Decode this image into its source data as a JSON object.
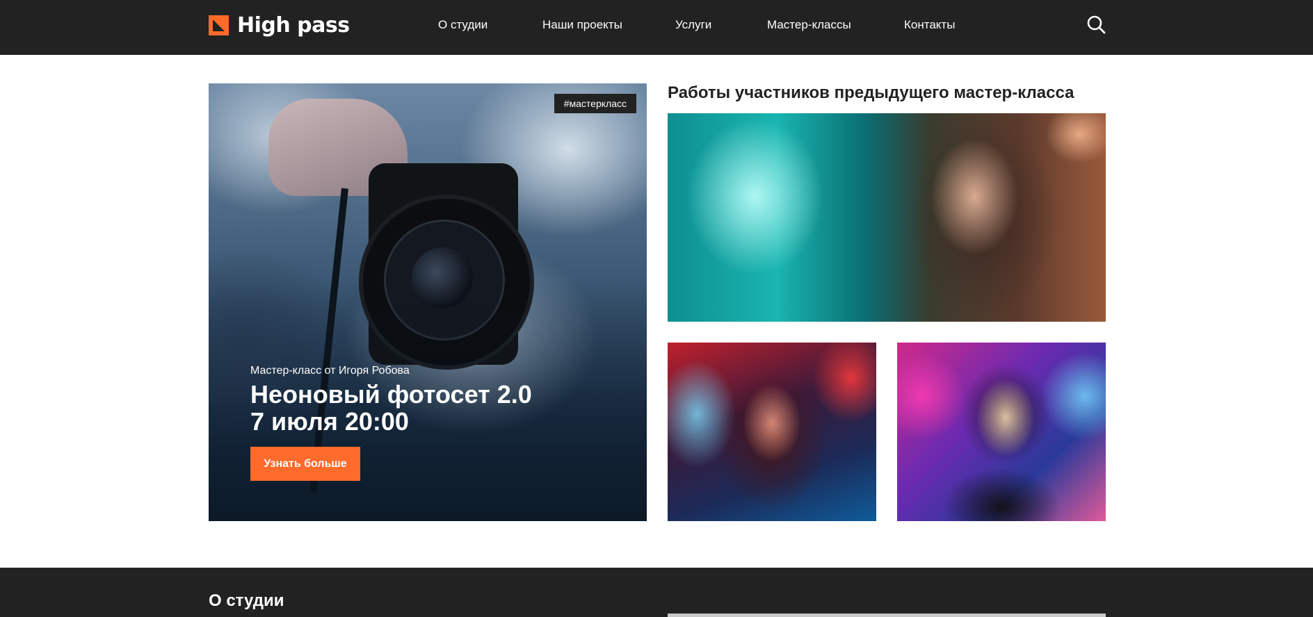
{
  "brand": {
    "name": "High pass",
    "accent": "#ff6b2b",
    "dark": "#222222"
  },
  "nav": {
    "items": [
      {
        "label": "О студии"
      },
      {
        "label": "Наши проекты"
      },
      {
        "label": "Услуги"
      },
      {
        "label": "Мастер-классы"
      },
      {
        "label": "Контакты"
      }
    ],
    "search_icon": "search-icon"
  },
  "hero": {
    "tag": "#мастеркласс",
    "subtitle": "Мастер-класс от Игоря Робова",
    "title_line1": "Неоновый фотосет 2.0",
    "title_line2": "7 июля 20:00",
    "button": "Узнать больше"
  },
  "works": {
    "title": "Работы участников предыдущего мастер-класса"
  },
  "about": {
    "title": "О студии"
  }
}
